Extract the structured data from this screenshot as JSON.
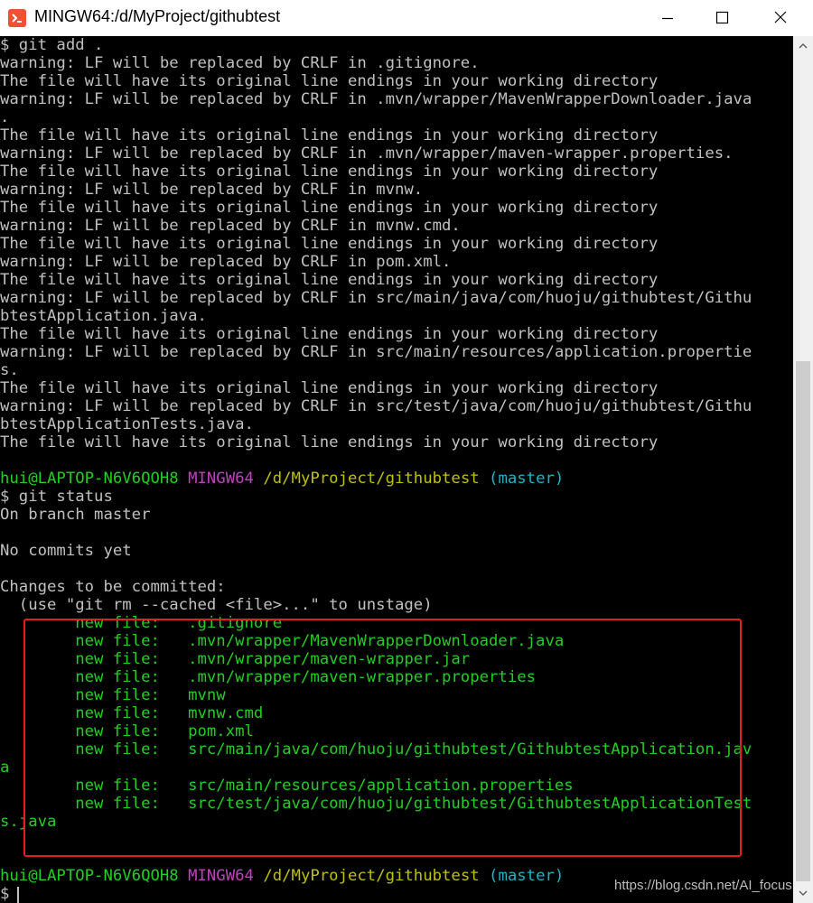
{
  "window": {
    "title": "MINGW64:/d/MyProject/githubtest"
  },
  "terminal": {
    "lines": [
      "$ git add .",
      "warning: LF will be replaced by CRLF in .gitignore.",
      "The file will have its original line endings in your working directory",
      "warning: LF will be replaced by CRLF in .mvn/wrapper/MavenWrapperDownloader.java",
      ".",
      "The file will have its original line endings in your working directory",
      "warning: LF will be replaced by CRLF in .mvn/wrapper/maven-wrapper.properties.",
      "The file will have its original line endings in your working directory",
      "warning: LF will be replaced by CRLF in mvnw.",
      "The file will have its original line endings in your working directory",
      "warning: LF will be replaced by CRLF in mvnw.cmd.",
      "The file will have its original line endings in your working directory",
      "warning: LF will be replaced by CRLF in pom.xml.",
      "The file will have its original line endings in your working directory",
      "warning: LF will be replaced by CRLF in src/main/java/com/huoju/githubtest/Githu",
      "btestApplication.java.",
      "The file will have its original line endings in your working directory",
      "warning: LF will be replaced by CRLF in src/main/resources/application.propertie",
      "s.",
      "The file will have its original line endings in your working directory",
      "warning: LF will be replaced by CRLF in src/test/java/com/huoju/githubtest/Githu",
      "btestApplicationTests.java.",
      "The file will have its original line endings in your working directory",
      "",
      "",
      "$ git status",
      "On branch master",
      "",
      "No commits yet",
      "",
      "Changes to be committed:",
      "  (use \"git rm --cached <file>...\" to unstage)",
      "        new file:   .gitignore",
      "        new file:   .mvn/wrapper/MavenWrapperDownloader.java",
      "        new file:   .mvn/wrapper/maven-wrapper.jar",
      "        new file:   .mvn/wrapper/maven-wrapper.properties",
      "        new file:   mvnw",
      "        new file:   mvnw.cmd",
      "        new file:   pom.xml",
      "        new file:   src/main/java/com/huoju/githubtest/GithubtestApplication.jav",
      "a",
      "        new file:   src/main/resources/application.properties",
      "        new file:   src/test/java/com/huoju/githubtest/GithubtestApplicationTest",
      "s.java",
      "",
      "",
      "",
      "$ "
    ],
    "prompts": [
      {
        "user_host": "hui@LAPTOP-N6V6QOH8",
        "shell": "MINGW64",
        "path": "/d/MyProject/githubtest",
        "branch": "(master)"
      },
      {
        "user_host": "hui@LAPTOP-N6V6QOH8",
        "shell": "MINGW64",
        "path": "/d/MyProject/githubtest",
        "branch": "(master)"
      }
    ]
  },
  "watermark": "https://blog.csdn.net/AI_focus",
  "colors": {
    "background": "#000000",
    "text": "#c0c0c0",
    "green": "#1fd01f",
    "magenta": "#c040c0",
    "yellow": "#c0c000",
    "cyan": "#1cb4c8",
    "highlight_box": "#e02020"
  }
}
